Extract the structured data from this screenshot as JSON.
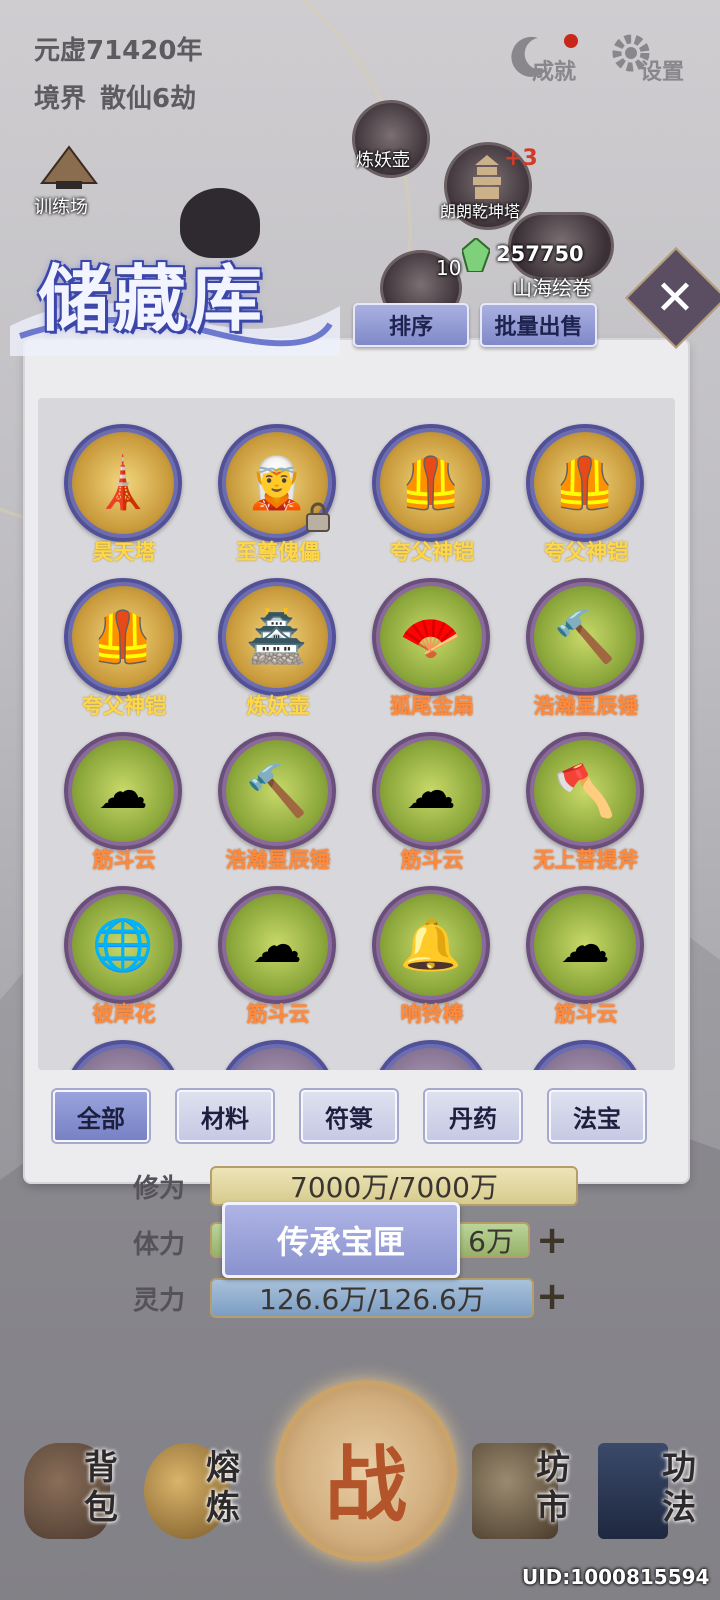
{
  "header": {
    "year": "元虚71420年",
    "realm_label": "境界",
    "realm_value": "散仙6劫",
    "achievements": "成就",
    "settings": "设置"
  },
  "map": {
    "training": "训练场",
    "furnace": "炼妖壶",
    "tower": "朗朗乾坤塔",
    "tower_badge": "+3",
    "scroll": "山海绘卷",
    "count": "10"
  },
  "currency": {
    "spirit_stones": "257750"
  },
  "storage": {
    "title": "储藏库",
    "sort_button": "排序",
    "batch_sell_button": "批量出售",
    "items": [
      {
        "name": "昊天塔",
        "color": "yellow",
        "quality": "gold",
        "icon": "tower-icon",
        "locked": false
      },
      {
        "name": "至尊傀儡",
        "color": "yellow",
        "quality": "gold",
        "icon": "puppet-icon",
        "locked": true
      },
      {
        "name": "夸父神铠",
        "color": "yellow",
        "quality": "gold",
        "icon": "armor-icon",
        "locked": false
      },
      {
        "name": "夸父神铠",
        "color": "yellow",
        "quality": "gold",
        "icon": "armor-icon",
        "locked": false
      },
      {
        "name": "夸父神铠",
        "color": "yellow",
        "quality": "gold",
        "icon": "armor-icon",
        "locked": false
      },
      {
        "name": "炼妖壶",
        "color": "yellow",
        "quality": "gold",
        "icon": "pagoda-icon",
        "locked": false
      },
      {
        "name": "狐尾金扇",
        "color": "orange",
        "quality": "green",
        "icon": "fan-icon",
        "locked": false
      },
      {
        "name": "浩瀚星辰锤",
        "color": "orange",
        "quality": "green",
        "icon": "hammer-icon",
        "locked": false
      },
      {
        "name": "筋斗云",
        "color": "orange",
        "quality": "green",
        "icon": "cloud-icon",
        "locked": false
      },
      {
        "name": "浩瀚星辰锤",
        "color": "orange",
        "quality": "green",
        "icon": "hammer-icon",
        "locked": false
      },
      {
        "name": "筋斗云",
        "color": "orange",
        "quality": "green",
        "icon": "cloud-icon",
        "locked": false
      },
      {
        "name": "无上菩提斧",
        "color": "orange",
        "quality": "green",
        "icon": "axe-icon",
        "locked": false
      },
      {
        "name": "彼岸花",
        "color": "orange",
        "quality": "green",
        "icon": "orb-icon",
        "locked": false
      },
      {
        "name": "筋斗云",
        "color": "orange",
        "quality": "green",
        "icon": "cloud-icon",
        "locked": false
      },
      {
        "name": "响铃棒",
        "color": "orange",
        "quality": "green",
        "icon": "bell-icon",
        "locked": false
      },
      {
        "name": "筋斗云",
        "color": "orange",
        "quality": "green",
        "icon": "cloud-icon",
        "locked": false
      }
    ],
    "tabs": [
      "全部",
      "材料",
      "符箓",
      "丹药",
      "法宝"
    ],
    "active_tab": "全部"
  },
  "stats": {
    "cultivation_label": "修为",
    "cultivation_value": "7000万/7000万",
    "stamina_label": "体力",
    "stamina_value_tail": "6万",
    "spirit_label": "灵力",
    "spirit_value": "126.6万/126.6万"
  },
  "inherit_button": "传承宝匣",
  "nav": {
    "bag": [
      "背",
      "包"
    ],
    "smelt": [
      "熔",
      "炼"
    ],
    "fight": "战",
    "market": [
      "坊",
      "市"
    ],
    "skills": [
      "功",
      "法"
    ]
  },
  "uid": "UID:1000815594",
  "colors": {
    "yellow_name": "#ffd84a",
    "orange_name": "#ff8a3c",
    "panel_bg": "#ececee",
    "button_blue": "#8089c9"
  }
}
